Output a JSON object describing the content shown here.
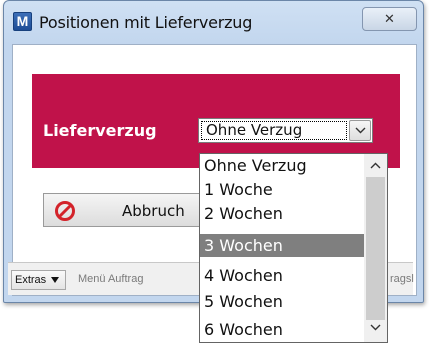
{
  "window": {
    "title": "Positionen mit Lieferverzug",
    "app_icon_letter": "M",
    "close_glyph": "✕"
  },
  "panel": {
    "color": "#c0124a",
    "label": "Lieferverzug",
    "select_value": "Ohne Verzug"
  },
  "cancel_button": {
    "label": "Abbruch"
  },
  "statusbar": {
    "extras_label": "Extras",
    "text_left": "Menü Auftrag",
    "text_right": "ragsl"
  },
  "dropdown": {
    "options": [
      "Ohne Verzug",
      "1 Woche",
      "2 Wochen",
      "3 Wochen",
      "4 Wochen",
      "5 Wochen",
      "6 Wochen"
    ],
    "selected_index": 3
  }
}
